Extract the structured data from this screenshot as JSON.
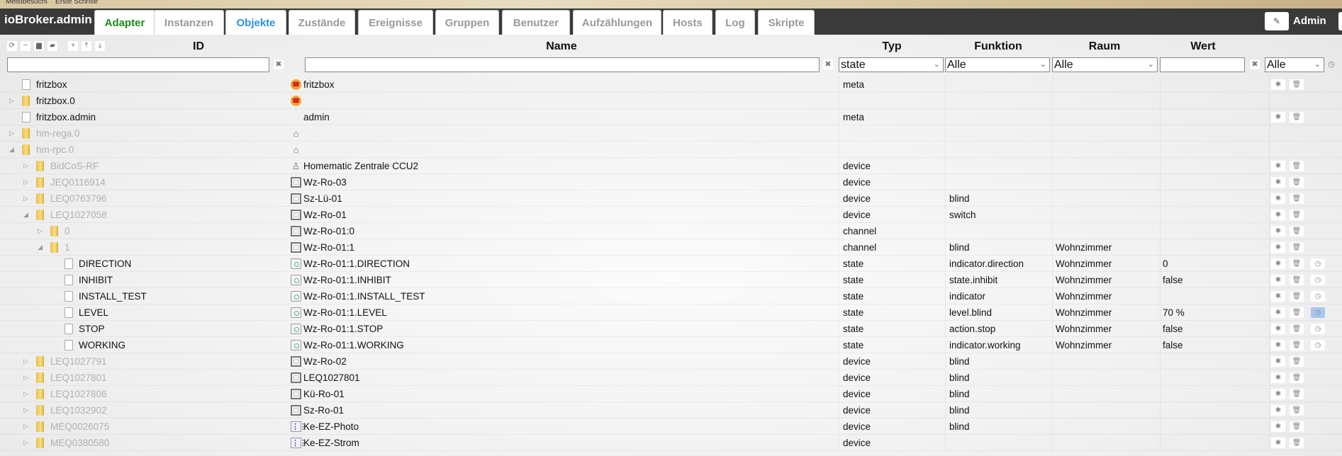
{
  "browser": {
    "bookmarks": [
      "Meistbesucht",
      "Erste Schritte"
    ]
  },
  "app": {
    "title": "ioBroker.admin",
    "user": "Admin"
  },
  "tabs": [
    {
      "label": "Adapter",
      "color": "#1a8a1a"
    },
    {
      "label": "Instanzen"
    },
    {
      "label": "Objekte",
      "color": "#2a8fe0",
      "active": true
    },
    {
      "label": "Zustände"
    },
    {
      "label": "Ereignisse"
    },
    {
      "label": "Gruppen"
    },
    {
      "label": "Benutzer"
    },
    {
      "label": "Aufzählungen"
    },
    {
      "label": "Hosts"
    },
    {
      "label": "Log"
    },
    {
      "label": "Skripte"
    }
  ],
  "columns": {
    "id": "ID",
    "name": "Name",
    "type": "Typ",
    "role": "Funktion",
    "room": "Raum",
    "value": "Wert"
  },
  "filters": {
    "id": "",
    "name": "",
    "type": "state",
    "role": "Alle",
    "room": "Alle",
    "value": "",
    "history": "Alle"
  },
  "rows": [
    {
      "id": "fritzbox",
      "level": 0,
      "expand": "none",
      "icon": "file",
      "name": "fritzbox",
      "nameIcon": "phone",
      "type": "meta",
      "actions": true
    },
    {
      "id": "fritzbox.0",
      "level": 0,
      "expand": "closed",
      "icon": "folder",
      "name": "",
      "nameIcon": "phone",
      "type": ""
    },
    {
      "id": "fritzbox.admin",
      "level": 0,
      "expand": "none",
      "icon": "file",
      "name": "admin",
      "nameIcon": "",
      "type": "meta",
      "actions": true
    },
    {
      "id": "hm-rega.0",
      "level": 0,
      "expand": "closed",
      "icon": "folder",
      "dim": true,
      "name": "",
      "nameIcon": "build",
      "type": ""
    },
    {
      "id": "hm-rpc.0",
      "level": 0,
      "expand": "open",
      "icon": "folder",
      "dim": true,
      "name": "",
      "nameIcon": "build",
      "type": ""
    },
    {
      "id": "BidCoS-RF",
      "level": 1,
      "expand": "closed",
      "icon": "folder",
      "dim": true,
      "name": "Homematic Zentrale CCU2",
      "nameIcon": "ccu",
      "type": "device",
      "actions": true
    },
    {
      "id": "JEQ0116914",
      "level": 1,
      "expand": "closed",
      "icon": "folder",
      "dim": true,
      "name": "Wz-Ro-03",
      "nameIcon": "device",
      "type": "device",
      "actions": true
    },
    {
      "id": "LEQ0763796",
      "level": 1,
      "expand": "closed",
      "icon": "folder",
      "dim": true,
      "name": "Sz-Lü-01",
      "nameIcon": "device",
      "type": "device",
      "role": "blind",
      "actions": true
    },
    {
      "id": "LEQ1027058",
      "level": 1,
      "expand": "open",
      "icon": "folder",
      "dim": true,
      "name": "Wz-Ro-01",
      "nameIcon": "device",
      "type": "device",
      "role": "switch",
      "actions": true
    },
    {
      "id": "0",
      "level": 2,
      "expand": "closed",
      "icon": "folder",
      "dim": true,
      "name": "Wz-Ro-01:0",
      "nameIcon": "device",
      "type": "channel",
      "actions": true
    },
    {
      "id": "1",
      "level": 2,
      "expand": "open",
      "icon": "folder",
      "dim": true,
      "name": "Wz-Ro-01:1",
      "nameIcon": "device",
      "type": "channel",
      "role": "blind",
      "room": "Wohnzimmer",
      "actions": true
    },
    {
      "id": "DIRECTION",
      "level": 3,
      "expand": "none",
      "icon": "file",
      "name": "Wz-Ro-01:1.DIRECTION",
      "nameIcon": "state",
      "type": "state",
      "role": "indicator.direction",
      "room": "Wohnzimmer",
      "value": "0",
      "actions": true,
      "history": true
    },
    {
      "id": "INHIBIT",
      "level": 3,
      "expand": "none",
      "icon": "file",
      "name": "Wz-Ro-01:1.INHIBIT",
      "nameIcon": "state",
      "type": "state",
      "role": "state.inhibit",
      "room": "Wohnzimmer",
      "value": "false",
      "actions": true,
      "history": true
    },
    {
      "id": "INSTALL_TEST",
      "level": 3,
      "expand": "none",
      "icon": "file",
      "name": "Wz-Ro-01:1.INSTALL_TEST",
      "nameIcon": "state",
      "type": "state",
      "role": "indicator",
      "room": "Wohnzimmer",
      "value": "",
      "actions": true,
      "history": true
    },
    {
      "id": "LEVEL",
      "level": 3,
      "expand": "none",
      "icon": "file",
      "name": "Wz-Ro-01:1.LEVEL",
      "nameIcon": "state",
      "type": "state",
      "role": "level.blind",
      "room": "Wohnzimmer",
      "value": "70 %",
      "actions": true,
      "history": true,
      "historyActive": true
    },
    {
      "id": "STOP",
      "level": 3,
      "expand": "none",
      "icon": "file",
      "name": "Wz-Ro-01:1.STOP",
      "nameIcon": "state",
      "type": "state",
      "role": "action.stop",
      "room": "Wohnzimmer",
      "value": "false",
      "actions": true,
      "history": true
    },
    {
      "id": "WORKING",
      "level": 3,
      "expand": "none",
      "icon": "file",
      "name": "Wz-Ro-01:1.WORKING",
      "nameIcon": "state",
      "type": "state",
      "role": "indicator.working",
      "room": "Wohnzimmer",
      "value": "false",
      "actions": true,
      "history": true
    },
    {
      "id": "LEQ1027791",
      "level": 1,
      "expand": "closed",
      "icon": "folder",
      "dim": true,
      "name": "Wz-Ro-02",
      "nameIcon": "device",
      "type": "device",
      "role": "blind",
      "actions": true
    },
    {
      "id": "LEQ1027801",
      "level": 1,
      "expand": "closed",
      "icon": "folder",
      "dim": true,
      "name": "LEQ1027801",
      "nameIcon": "device",
      "type": "device",
      "role": "blind",
      "actions": true
    },
    {
      "id": "LEQ1027806",
      "level": 1,
      "expand": "closed",
      "icon": "folder",
      "dim": true,
      "name": "Kü-Ro-01",
      "nameIcon": "device",
      "type": "device",
      "role": "blind",
      "actions": true
    },
    {
      "id": "LEQ1032902",
      "level": 1,
      "expand": "closed",
      "icon": "folder",
      "dim": true,
      "name": "Sz-Ro-01",
      "nameIcon": "device",
      "type": "device",
      "role": "blind",
      "actions": true
    },
    {
      "id": "MEQ0026075",
      "level": 1,
      "expand": "closed",
      "icon": "folder",
      "dim": true,
      "name": "Ke-EZ-Photo",
      "nameIcon": "sensor",
      "type": "device",
      "role": "blind",
      "actions": true
    },
    {
      "id": "MEQ0380580",
      "level": 1,
      "expand": "closed",
      "icon": "folder",
      "dim": true,
      "name": "Ke-EZ-Strom",
      "nameIcon": "sensor",
      "type": "device",
      "actions": true
    }
  ]
}
